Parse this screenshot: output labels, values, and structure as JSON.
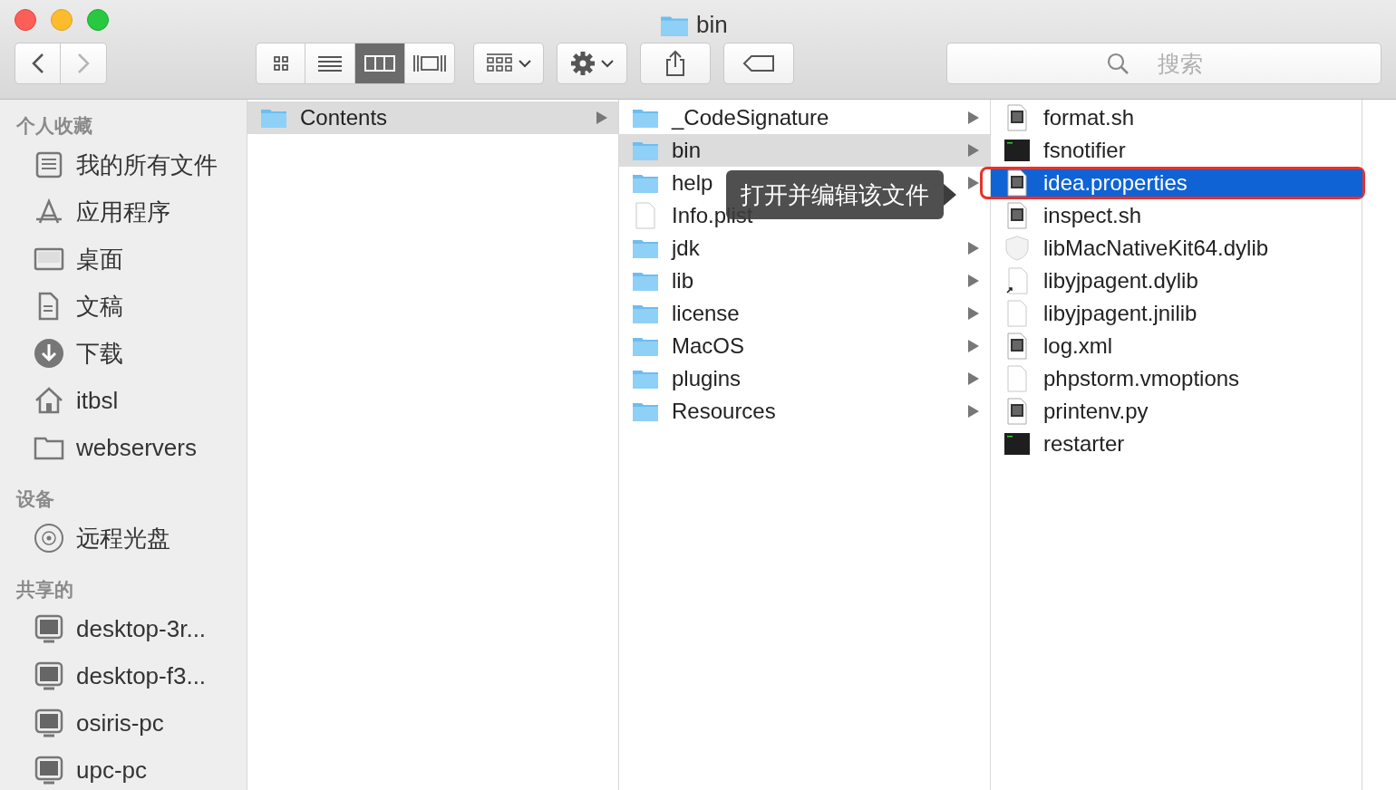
{
  "window": {
    "title": "bin"
  },
  "toolbar": {
    "nav": [
      {
        "kind": "back",
        "disabled": false
      },
      {
        "kind": "forward",
        "disabled": true
      }
    ],
    "view_modes": [
      {
        "kind": "icons",
        "selected": false
      },
      {
        "kind": "list",
        "selected": false
      },
      {
        "kind": "columns",
        "selected": true
      },
      {
        "kind": "gallery",
        "selected": false
      }
    ],
    "search": {
      "placeholder": "搜索"
    }
  },
  "sidebar": {
    "sections": [
      {
        "title": "个人收藏",
        "items": [
          {
            "label": "我的所有文件",
            "kind": "allfiles"
          },
          {
            "label": "应用程序",
            "kind": "apps"
          },
          {
            "label": "桌面",
            "kind": "desktop"
          },
          {
            "label": "文稿",
            "kind": "docs"
          },
          {
            "label": "下载",
            "kind": "download"
          },
          {
            "label": "itbsl",
            "kind": "home"
          },
          {
            "label": "webservers",
            "kind": "folder"
          }
        ]
      },
      {
        "title": "设备",
        "items": [
          {
            "label": "远程光盘",
            "kind": "disc"
          }
        ]
      },
      {
        "title": "共享的",
        "items": [
          {
            "label": "desktop-3r...",
            "kind": "computer"
          },
          {
            "label": "desktop-f3...",
            "kind": "computer"
          },
          {
            "label": "osiris-pc",
            "kind": "computer"
          },
          {
            "label": "upc-pc",
            "kind": "computer"
          }
        ]
      }
    ]
  },
  "columns": [
    {
      "focused": false,
      "items": [
        {
          "name": "Contents",
          "kind": "folder",
          "selected": true
        }
      ]
    },
    {
      "focused": false,
      "items": [
        {
          "name": "_CodeSignature",
          "kind": "folder",
          "selected": false
        },
        {
          "name": "bin",
          "kind": "folder",
          "selected": true
        },
        {
          "name": "help",
          "kind": "folder",
          "selected": false
        },
        {
          "name": "Info.plist",
          "kind": "blank",
          "selected": false
        },
        {
          "name": "jdk",
          "kind": "folder",
          "selected": false
        },
        {
          "name": "lib",
          "kind": "folder",
          "selected": false
        },
        {
          "name": "license",
          "kind": "folder",
          "selected": false
        },
        {
          "name": "MacOS",
          "kind": "folder",
          "selected": false
        },
        {
          "name": "plugins",
          "kind": "folder",
          "selected": false
        },
        {
          "name": "Resources",
          "kind": "folder",
          "selected": false
        }
      ]
    },
    {
      "focused": true,
      "items": [
        {
          "name": "format.sh",
          "kind": "script",
          "selected": false
        },
        {
          "name": "fsnotifier",
          "kind": "executable",
          "selected": false
        },
        {
          "name": "idea.properties",
          "kind": "script",
          "selected": true
        },
        {
          "name": "inspect.sh",
          "kind": "script",
          "selected": false
        },
        {
          "name": "libMacNativeKit64.dylib",
          "kind": "library",
          "selected": false
        },
        {
          "name": "libyjpagent.dylib",
          "kind": "alias",
          "selected": false
        },
        {
          "name": "libyjpagent.jnilib",
          "kind": "blank",
          "selected": false
        },
        {
          "name": "log.xml",
          "kind": "script",
          "selected": false
        },
        {
          "name": "phpstorm.vmoptions",
          "kind": "blank",
          "selected": false
        },
        {
          "name": "printenv.py",
          "kind": "script",
          "selected": false
        },
        {
          "name": "restarter",
          "kind": "executable",
          "selected": false
        }
      ]
    }
  ],
  "tooltip": {
    "text": "打开并编辑该文件"
  }
}
